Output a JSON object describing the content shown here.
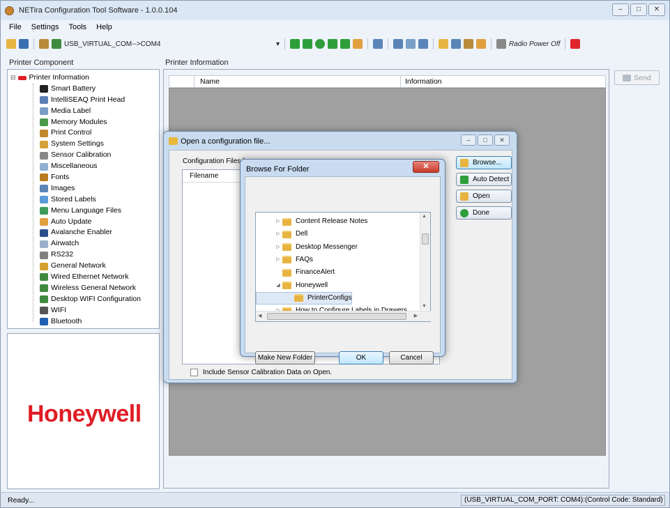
{
  "window": {
    "title": "NETira Configuration Tool Software - 1.0.0.104",
    "controls": [
      "–",
      "□",
      "✕"
    ]
  },
  "menu": [
    "File",
    "Settings",
    "Tools",
    "Help"
  ],
  "toolbar": {
    "port_select": "USB_VIRTUAL_COM-->COM4",
    "radio_power": "Radio Power Off"
  },
  "left_panel": {
    "label": "Printer Component",
    "root": "Printer Information",
    "items": [
      {
        "label": "Smart Battery",
        "icon": "battery-icon",
        "color": "#222"
      },
      {
        "label": "IntelliSEAQ Print Head",
        "icon": "printhead-icon",
        "color": "#5a7fb3"
      },
      {
        "label": "Media Label",
        "icon": "label-icon",
        "color": "#7aa0c8"
      },
      {
        "label": "Memory Modules",
        "icon": "memory-icon",
        "color": "#4a9a4a"
      },
      {
        "label": "Print Control",
        "icon": "print-control-icon",
        "color": "#c0892f"
      },
      {
        "label": "System Settings",
        "icon": "wrench-icon",
        "color": "#d4a23a"
      },
      {
        "label": "Sensor Calibration",
        "icon": "sensor-icon",
        "color": "#888"
      },
      {
        "label": "Miscellaneous",
        "icon": "misc-icon",
        "color": "#8fb0d0"
      },
      {
        "label": "Fonts",
        "icon": "font-icon",
        "color": "#b87c1e"
      },
      {
        "label": "Images",
        "icon": "image-icon",
        "color": "#5b84b9"
      },
      {
        "label": "Stored Labels",
        "icon": "stored-labels-icon",
        "color": "#5a9ad8"
      },
      {
        "label": "Menu Language Files",
        "icon": "language-icon",
        "color": "#3e9b5a"
      },
      {
        "label": "Auto Update",
        "icon": "auto-update-icon",
        "color": "#e0a040"
      },
      {
        "label": "Avalanche Enabler",
        "icon": "avalanche-icon",
        "color": "#2a4f8a"
      },
      {
        "label": "Airwatch",
        "icon": "airwatch-icon",
        "color": "#9ab0c8"
      },
      {
        "label": "RS232",
        "icon": "rs232-icon",
        "color": "#808080"
      },
      {
        "label": "General Network",
        "icon": "network-icon",
        "color": "#d6a030"
      },
      {
        "label": "Wired Ethernet Network",
        "icon": "ethernet-icon",
        "color": "#3f8a3f"
      },
      {
        "label": "Wireless General Network",
        "icon": "wireless-icon",
        "color": "#3f8a3f"
      },
      {
        "label": "Desktop WIFI Configuration",
        "icon": "wifi-config-icon",
        "color": "#3f8a3f"
      },
      {
        "label": "WIFI",
        "icon": "wifi-icon",
        "color": "#555"
      },
      {
        "label": "Bluetooth",
        "icon": "bluetooth-icon",
        "color": "#1d5fb0"
      }
    ]
  },
  "logo": {
    "text": "Honeywell",
    "color": "#e01c24"
  },
  "main": {
    "label": "Printer Information",
    "columns": [
      "Name",
      "Information"
    ],
    "send_label": "Send"
  },
  "open_dialog": {
    "title": "Open a configuration file...",
    "config_label": "Configuration Files fo",
    "filename_header": "Filename",
    "buttons": {
      "browse": "Browse...",
      "auto_detect": "Auto Detect",
      "open": "Open",
      "done": "Done"
    },
    "checkbox_label": "Include Sensor Calibration Data on Open."
  },
  "browse_dialog": {
    "title": "Browse For Folder",
    "folders": [
      {
        "name": "Content Release Notes",
        "expander": "▷",
        "level": 0
      },
      {
        "name": "Dell",
        "expander": "▷",
        "level": 0
      },
      {
        "name": "Desktop Messenger",
        "expander": "▷",
        "level": 0
      },
      {
        "name": "FAQs",
        "expander": "▷",
        "level": 0
      },
      {
        "name": "FinanceAlert",
        "expander": "",
        "level": 0
      },
      {
        "name": "Honeywell",
        "expander": "◢",
        "level": 0
      },
      {
        "name": "PrinterConfigs",
        "expander": "",
        "level": 1,
        "selected": true
      },
      {
        "name": "How to Configure Labels in Drawers",
        "expander": "▷",
        "level": 0
      }
    ],
    "make_folder": "Make New Folder",
    "ok": "OK",
    "cancel": "Cancel"
  },
  "status": {
    "left": "Ready...",
    "right": "(USB_VIRTUAL_COM_PORT: COM4):(Control Code: Standard)"
  }
}
